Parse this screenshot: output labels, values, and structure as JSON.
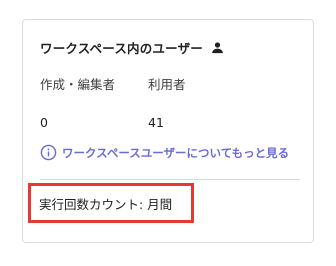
{
  "card": {
    "title": "ワークスペース内のユーザー",
    "title_icon": "person-icon",
    "stats": {
      "editors": {
        "label": "作成・編集者",
        "value": "0"
      },
      "users": {
        "label": "利用者",
        "value": "41"
      }
    },
    "learn_more": {
      "icon": "info-icon",
      "label": "ワークスペースユーザーについてもっと見る"
    },
    "execution_count": "実行回数カウント: 月間"
  },
  "colors": {
    "link": "#6b6bd6",
    "highlight_border": "#e53935",
    "card_border": "#dadce0"
  }
}
